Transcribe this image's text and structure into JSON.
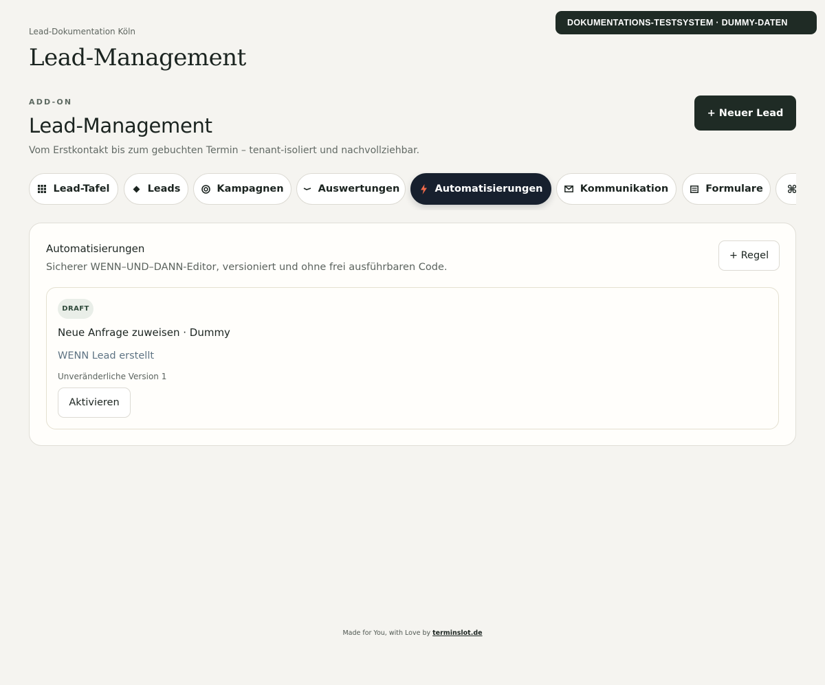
{
  "env_banner": "DOKUMENTATIONS-TESTSYSTEM · DUMMY-DATEN",
  "breadcrumb": "Lead-Dokumentation Köln",
  "page_title": "Lead-Management",
  "header": {
    "eyebrow": "ADD-ON",
    "title": "Lead-Management",
    "subtitle": "Vom Erstkontakt bis zum gebuchten Termin – tenant-isoliert und nachvollziehbar.",
    "new_lead_label": "+ Neuer Lead"
  },
  "tabs": [
    {
      "label": "Lead-Tafel",
      "icon": "grid-icon"
    },
    {
      "label": "Leads",
      "icon": "diamond-icon"
    },
    {
      "label": "Kampagnen",
      "icon": "target-icon"
    },
    {
      "label": "Auswertungen",
      "icon": "trend-icon"
    },
    {
      "label": "Automatisierungen",
      "icon": "lightning-icon"
    },
    {
      "label": "Kommunikation",
      "icon": "mail-icon"
    },
    {
      "label": "Formulare",
      "icon": "form-icon"
    },
    {
      "label": "",
      "icon": "command-icon"
    }
  ],
  "active_tab": "Automatisierungen",
  "panel": {
    "title": "Automatisierungen",
    "subtitle": "Sicherer WENN–UND–DANN-Editor, versioniert und ohne frei ausführbaren Code.",
    "add_rule_label": "+ Regel",
    "rule": {
      "status": "DRAFT",
      "name": "Neue Anfrage zuweisen · Dummy",
      "condition": "WENN Lead erstellt",
      "version": "Unveränderliche Version 1",
      "activate_label": "Aktivieren"
    }
  },
  "footer": {
    "text": "Made for You, with Love by",
    "link": "terminslot.de"
  },
  "colors": {
    "background": "#f5f4f0",
    "primary_dark": "#1f2b25",
    "active_tab": "#17202e",
    "accent_lightning": "#ef6a4a"
  }
}
